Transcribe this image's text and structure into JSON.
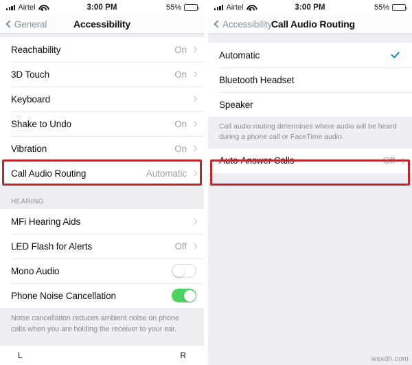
{
  "status_bar": {
    "carrier": "Airtel",
    "time": "3:00 PM",
    "battery_percent": "55%",
    "signal_icon": "signal-bars-icon",
    "wifi_icon": "wifi-icon",
    "battery_icon": "battery-icon"
  },
  "left_screen": {
    "nav": {
      "back_label": "General",
      "title": "Accessibility"
    },
    "rows": [
      {
        "label": "Reachability",
        "value": "On",
        "chevron": true
      },
      {
        "label": "3D Touch",
        "value": "On",
        "chevron": true
      },
      {
        "label": "Keyboard",
        "value": "",
        "chevron": true
      },
      {
        "label": "Shake to Undo",
        "value": "On",
        "chevron": true
      },
      {
        "label": "Vibration",
        "value": "On",
        "chevron": true
      },
      {
        "label": "Call Audio Routing",
        "value": "Automatic",
        "chevron": true
      }
    ],
    "section_header": "HEARING",
    "hearing_rows": [
      {
        "label": "MFi Hearing Aids",
        "value": "",
        "type": "chevron"
      },
      {
        "label": "LED Flash for Alerts",
        "value": "Off",
        "type": "chevron"
      },
      {
        "label": "Mono Audio",
        "value": "",
        "type": "toggle",
        "on": false
      },
      {
        "label": "Phone Noise Cancellation",
        "value": "",
        "type": "toggle",
        "on": true
      }
    ],
    "note": "Noise cancellation reduces ambient noise on phone calls when you are holding the receiver to your ear.",
    "balance_left": "L",
    "balance_right": "R"
  },
  "right_screen": {
    "nav": {
      "back_label": "Accessibility",
      "title": "Call Audio Routing"
    },
    "options": [
      {
        "label": "Automatic",
        "selected": true
      },
      {
        "label": "Bluetooth Headset",
        "selected": false
      },
      {
        "label": "Speaker",
        "selected": false
      }
    ],
    "note": "Call audio routing determines where audio will be heard during a phone call or FaceTime audio.",
    "auto_answer": {
      "label": "Auto-Answer Calls",
      "value": "Off"
    }
  },
  "highlight_color": "#c0272d",
  "accent_color": "#0a84d6",
  "toggle_on_color": "#4cd25f",
  "watermark": "wsxdn.com"
}
